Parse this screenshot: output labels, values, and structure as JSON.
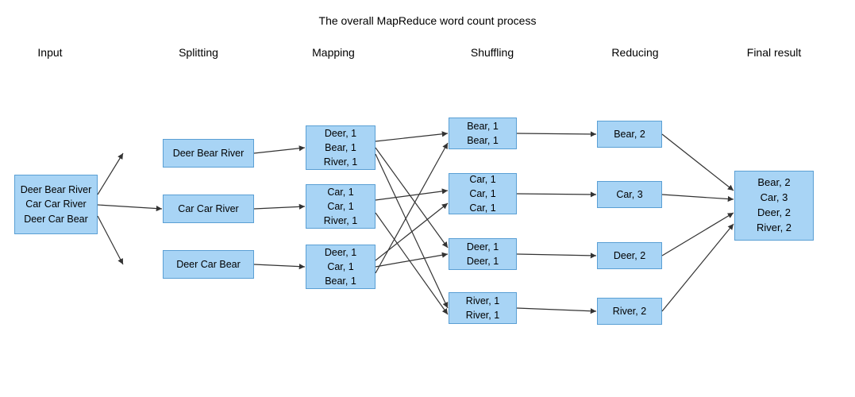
{
  "title": "The overall MapReduce word count process",
  "stage_labels": {
    "input": "Input",
    "splitting": "Splitting",
    "mapping": "Mapping",
    "shuffling": "Shuffling",
    "reducing": "Reducing",
    "final_result": "Final result"
  },
  "boxes": {
    "input": "Deer Bear River\nCar Car River\nDeer Car Bear",
    "split1": "Deer Bear River",
    "split2": "Car Car River",
    "split3": "Deer Car Bear",
    "map1": "Deer, 1\nBear, 1\nRiver, 1",
    "map2": "Car, 1\nCar, 1\nRiver, 1",
    "map3": "Deer, 1\nCar, 1\nBear, 1",
    "shuf1": "Bear, 1\nBear, 1",
    "shuf2": "Car, 1\nCar, 1\nCar, 1",
    "shuf3": "Deer, 1\nDeer, 1",
    "shuf4": "River, 1\nRiver, 1",
    "red1": "Bear, 2",
    "red2": "Car, 3",
    "red3": "Deer, 2",
    "red4": "River, 2",
    "final": "Bear, 2\nCar, 3\nDeer, 2\nRiver, 2"
  }
}
